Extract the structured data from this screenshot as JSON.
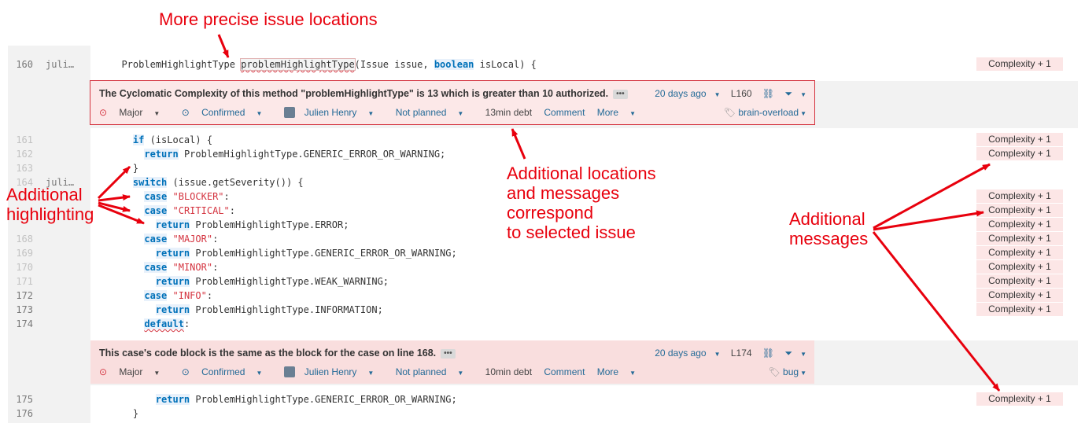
{
  "annotations": {
    "precise": "More precise issue locations",
    "highlighting": "Additional\nhighlighting",
    "locations": "Additional locations\nand messages\ncorrespond\nto selected issue",
    "messages": "Additional\nmessages"
  },
  "lines": [
    {
      "num": "160",
      "blame": "juli…",
      "code_html": "  ProblemHighlightType <span class=\"hl squig\">problemHighlightType</span>(Issue issue, <span class=\"kw\">boolean</span> isLocal) {",
      "cx": "Complexity + 1",
      "dim": false
    },
    {
      "num": "161",
      "blame": "",
      "code_html": "    <span class=\"kw\">if</span> (isLocal) {",
      "cx": "Complexity + 1",
      "dim": true
    },
    {
      "num": "162",
      "blame": "",
      "code_html": "      <span class=\"kw\">return</span> ProblemHighlightType.GENERIC_ERROR_OR_WARNING;",
      "cx": "Complexity + 1",
      "dim": true
    },
    {
      "num": "163",
      "blame": "",
      "code_html": "    }",
      "cx": "",
      "dim": true
    },
    {
      "num": "164",
      "blame": "juli…",
      "code_html": "    <span class=\"kw\">switch</span> (issue.getSeverity()) {",
      "cx": "",
      "dim": true
    },
    {
      "num": "",
      "blame": "",
      "code_html": "      <span class=\"kw\">case</span> <span class=\"str\">\"BLOCKER\"</span>:",
      "cx": "Complexity + 1",
      "dim": true
    },
    {
      "num": "",
      "blame": "",
      "code_html": "      <span class=\"kw\">case</span> <span class=\"str\">\"CRITICAL\"</span>:",
      "cx": "Complexity + 1",
      "dim": true
    },
    {
      "num": "",
      "blame": "",
      "code_html": "        <span class=\"kw\">return</span> ProblemHighlightType.ERROR;",
      "cx": "Complexity + 1",
      "dim": true
    },
    {
      "num": "168",
      "blame": "",
      "code_html": "      <span class=\"kw\">case</span> <span class=\"str\">\"MAJOR\"</span>:",
      "cx": "Complexity + 1",
      "dim": true
    },
    {
      "num": "169",
      "blame": "",
      "code_html": "        <span class=\"kw\">return</span> ProblemHighlightType.GENERIC_ERROR_OR_WARNING;",
      "cx": "Complexity + 1",
      "dim": true
    },
    {
      "num": "170",
      "blame": "",
      "code_html": "      <span class=\"kw\">case</span> <span class=\"str\">\"MINOR\"</span>:",
      "cx": "Complexity + 1",
      "dim": true
    },
    {
      "num": "171",
      "blame": "",
      "code_html": "        <span class=\"kw\">return</span> ProblemHighlightType.WEAK_WARNING;",
      "cx": "Complexity + 1",
      "dim": true
    },
    {
      "num": "172",
      "blame": "",
      "code_html": "      <span class=\"kw\">case</span> <span class=\"str\">\"INFO\"</span>:",
      "cx": "Complexity + 1",
      "dim": false
    },
    {
      "num": "173",
      "blame": "",
      "code_html": "        <span class=\"kw\">return</span> ProblemHighlightType.INFORMATION;",
      "cx": "Complexity + 1",
      "dim": false
    },
    {
      "num": "174",
      "blame": "",
      "code_html": "      <span class=\"kw squig\">default</span>:",
      "cx": "",
      "dim": false
    },
    {
      "num": "175",
      "blame": "",
      "code_html": "        <span class=\"kw\">return</span> ProblemHighlightType.GENERIC_ERROR_OR_WARNING;",
      "cx": "Complexity + 1",
      "dim": false
    },
    {
      "num": "176",
      "blame": "",
      "code_html": "    }",
      "cx": "",
      "dim": false
    }
  ],
  "issue1": {
    "message": "The Cyclomatic Complexity of this method \"problemHighlightType\" is 13 which is greater than 10 authorized.",
    "dots": "•••",
    "age": "20 days ago",
    "line": "L160",
    "severity": "Major",
    "status": "Confirmed",
    "assignee": "Julien Henry",
    "plan": "Not planned",
    "debt": "13min debt",
    "comment": "Comment",
    "more": "More",
    "tag": "brain-overload"
  },
  "issue2": {
    "message": "This case's code block is the same as the block for the case on line 168.",
    "dots": "•••",
    "age": "20 days ago",
    "line": "L174",
    "severity": "Major",
    "status": "Confirmed",
    "assignee": "Julien Henry",
    "plan": "Not planned",
    "debt": "10min debt",
    "comment": "Comment",
    "more": "More",
    "tag": "bug"
  },
  "colors": {
    "annotation": "#e8000d",
    "keyword": "#0071b9",
    "string": "#d4333f",
    "issue_bg": "#f9dede",
    "complexity_bg": "#fce6e6"
  }
}
